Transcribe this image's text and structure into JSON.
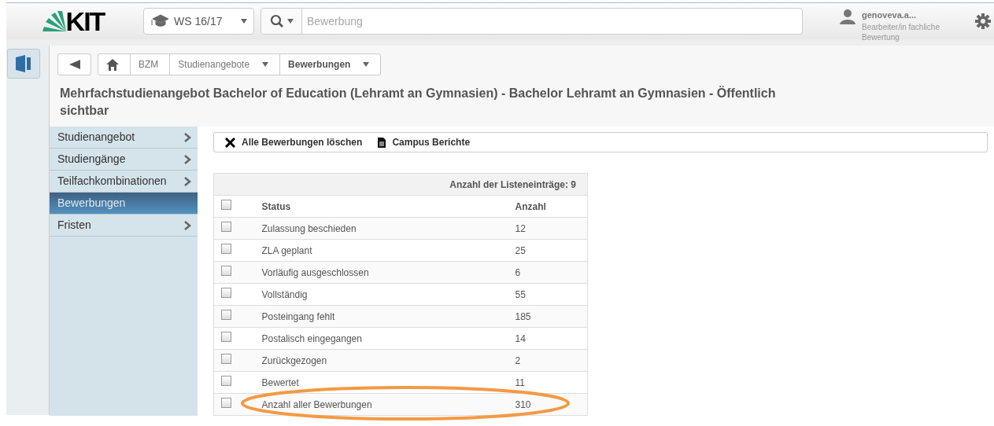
{
  "header": {
    "logo": "KIT",
    "semester": "WS 16/17",
    "search": {
      "placeholder": "Bewerbung"
    },
    "user": {
      "name": "genoveva.a...",
      "role": "Bearbeiter/in fachliche Bewertung"
    }
  },
  "breadcrumb": [
    {
      "label": "BZM",
      "dropdown": false,
      "current": false
    },
    {
      "label": "Studienangebote",
      "dropdown": true,
      "current": false
    },
    {
      "label": "Bewerbungen",
      "dropdown": true,
      "current": true
    }
  ],
  "page_title": "Mehrfachstudienangebot Bachelor of Education (Lehramt an Gymnasien) - Bachelor Lehramt an Gymnasien - Öffentlich sichtbar",
  "sidebar": {
    "items": [
      {
        "label": "Studienangebot",
        "selected": false,
        "expandable": true
      },
      {
        "label": "Studiengänge",
        "selected": false,
        "expandable": true
      },
      {
        "label": "Teilfachkombinationen",
        "selected": false,
        "expandable": true
      },
      {
        "label": "Bewerbungen",
        "selected": true,
        "expandable": false
      },
      {
        "label": "Fristen",
        "selected": false,
        "expandable": true
      }
    ]
  },
  "toolbar": [
    {
      "kind": "delete",
      "label": "Alle Bewerbungen löschen"
    },
    {
      "kind": "report",
      "label": "Campus Berichte"
    }
  ],
  "table": {
    "summary": "Anzahl der Listeneinträge: 9",
    "header_checked": false,
    "columns": [
      "Status",
      "Anzahl"
    ],
    "rows": [
      {
        "status": "Zulassung beschieden",
        "count": "12",
        "checked": false,
        "highlighted": false
      },
      {
        "status": "ZLA geplant",
        "count": "25",
        "checked": false,
        "highlighted": false
      },
      {
        "status": "Vorläufig ausgeschlossen",
        "count": "6",
        "checked": false,
        "highlighted": false
      },
      {
        "status": "Vollständig",
        "count": "55",
        "checked": false,
        "highlighted": false
      },
      {
        "status": "Posteingang fehlt",
        "count": "185",
        "checked": false,
        "highlighted": false
      },
      {
        "status": "Postalisch eingegangen",
        "count": "14",
        "checked": false,
        "highlighted": false
      },
      {
        "status": "Zurückgezogen",
        "count": "2",
        "checked": false,
        "highlighted": false
      },
      {
        "status": "Bewertet",
        "count": "11",
        "checked": false,
        "highlighted": false
      },
      {
        "status": "Anzahl aller Bewerbungen",
        "count": "310",
        "checked": false,
        "highlighted": true
      }
    ]
  }
}
